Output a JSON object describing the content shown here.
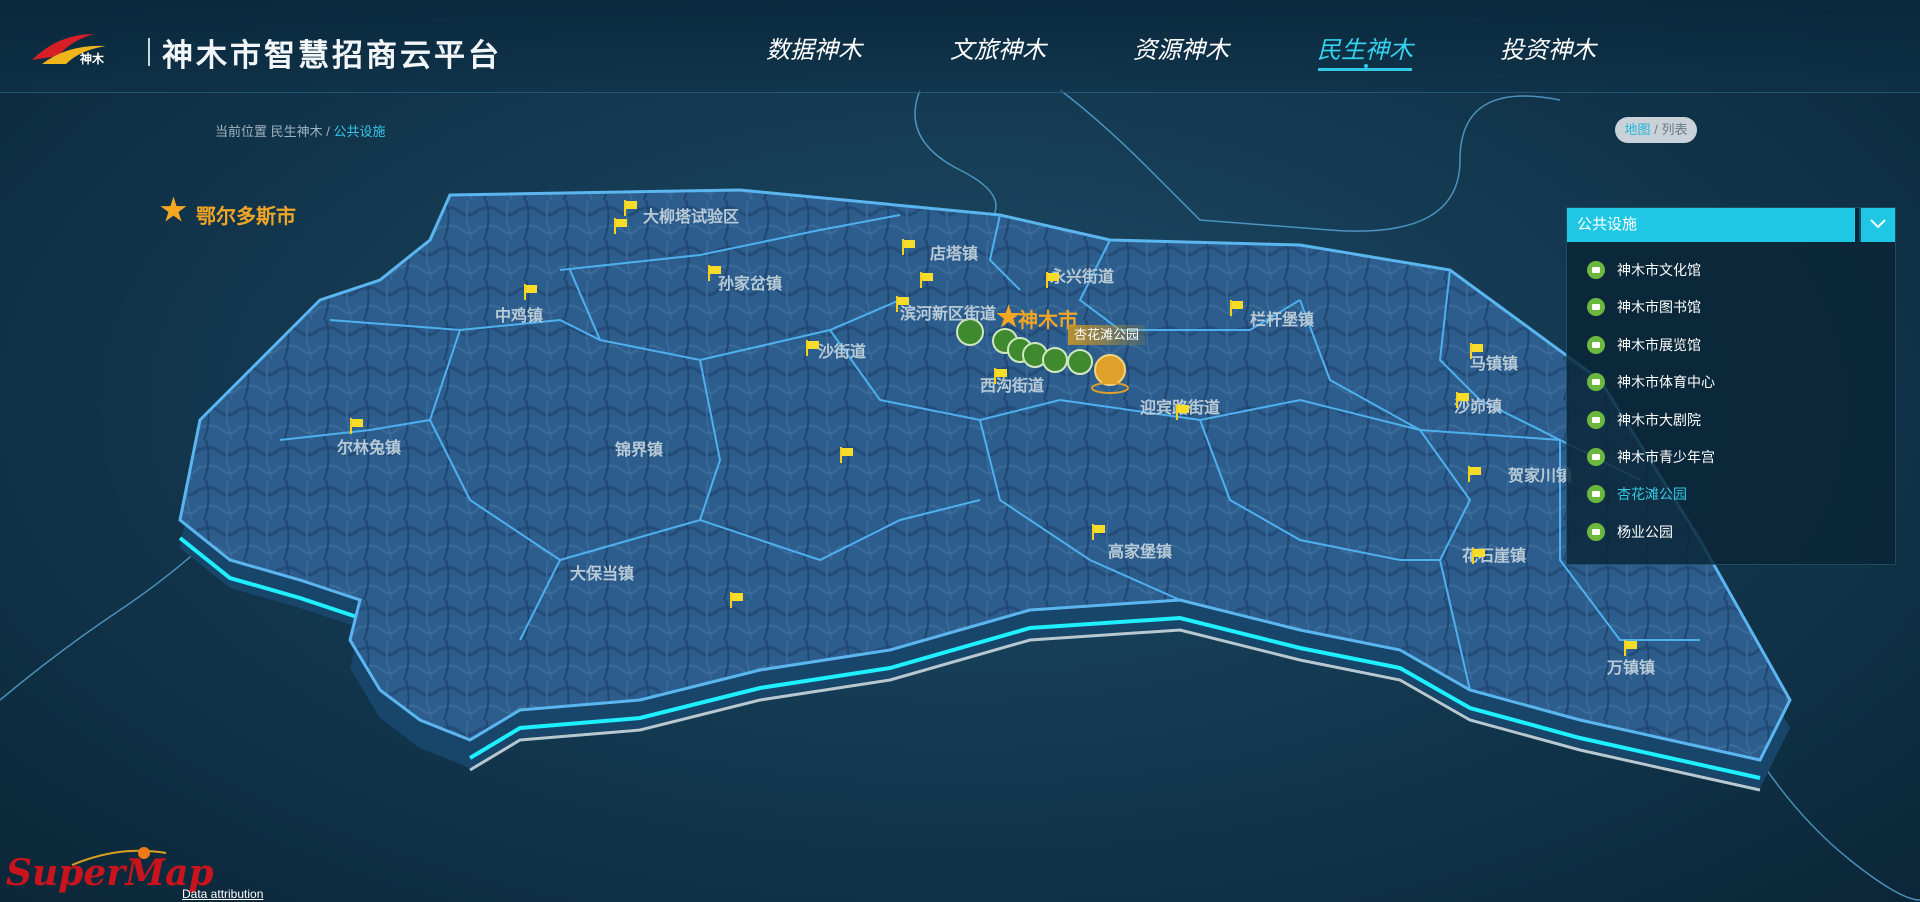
{
  "header": {
    "title": "神木市智慧招商云平台",
    "logo_caption": "神木",
    "nav": [
      {
        "label": "数据神木",
        "active": false
      },
      {
        "label": "文旅神木",
        "active": false
      },
      {
        "label": "资源神木",
        "active": false
      },
      {
        "label": "民生神木",
        "active": true
      },
      {
        "label": "投资神木",
        "active": false
      }
    ]
  },
  "breadcrumb": {
    "prefix": "当前位置",
    "parent": "民生神木",
    "separator": "/",
    "current": "公共设施"
  },
  "view_toggle": {
    "map": "地图",
    "separator": "/",
    "list": "列表",
    "active": "map"
  },
  "map": {
    "neighbor_city": "鄂尔多斯市",
    "city": "神木市",
    "places": [
      "大柳塔试验区",
      "店塔镇",
      "永兴街道",
      "孙家岔镇",
      "中鸡镇",
      "滨河新区街道",
      "栏杆堡镇",
      "沙街道",
      "西沟街道",
      "迎宾路街道",
      "尔林兔镇",
      "锦界镇",
      "马镇镇",
      "沙峁镇",
      "贺家川镇",
      "高家堡镇",
      "大保当镇",
      "花石崖镇",
      "万镇镇"
    ],
    "tooltip": "杏花滩公园"
  },
  "panel": {
    "category": "公共设施",
    "items": [
      {
        "label": "神木市文化馆",
        "selected": false
      },
      {
        "label": "神木市图书馆",
        "selected": false
      },
      {
        "label": "神木市展览馆",
        "selected": false
      },
      {
        "label": "神木市体育中心",
        "selected": false
      },
      {
        "label": "神木市大剧院",
        "selected": false
      },
      {
        "label": "神木市青少年宫",
        "selected": false
      },
      {
        "label": "杏花滩公园",
        "selected": true
      },
      {
        "label": "杨业公园",
        "selected": false
      }
    ]
  },
  "footer": {
    "brand": "SuperMap",
    "attribution": "Data attribution"
  },
  "colors": {
    "accent": "#1fc7e4",
    "star": "#f5a623",
    "poi": "#6cb83f",
    "map_fill": "#2a5c8c",
    "boundary": "#4fb0ee"
  }
}
